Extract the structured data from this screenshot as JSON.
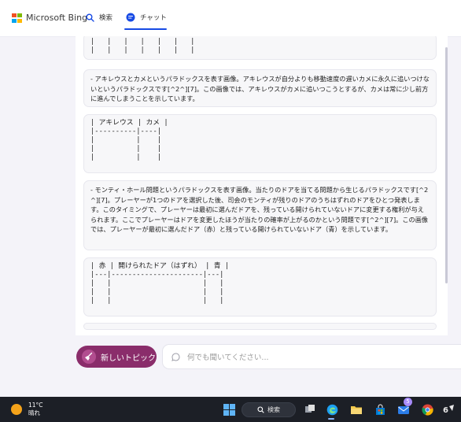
{
  "header": {
    "logo_text": "Microsoft Bing",
    "nav": [
      {
        "label": "検索",
        "icon": "search-icon"
      },
      {
        "label": "チャット",
        "icon": "chat-icon"
      }
    ],
    "active_tab": "チャット"
  },
  "conversation": {
    "table_fragment_top": "|   |   |   |   |   |   |\n|   |   |   |   |   |   |",
    "para1": "- アキレウスとカメというパラドックスを表す画像。アキレウスが自分よりも移動速度の遅いカメに永久に追いつけないというパラドックスです[^2^][7]。この画像では、アキレウスがカメに追いつこうとするが、カメは常に少し前方に進んでしまうことを示しています。",
    "table1": "| アキレウス | カメ |\n|----------|----|\n|          |    |\n|          |    |\n|          |    |",
    "para2": "- モンティ・ホール問題というパラドックスを表す画像。当たりのドアを当てる問題から生じるパラドックスです[^2^][7]。プレーヤーが1つのドアを選択した後、司会のモンティが残りのドアのうちはずれのドアをひとつ発表します。このタイミングで、プレーヤーは最初に選んだドアを、残っている開けられていないドアに変更する権利が与えられます。ここでプレーヤーはドアを変更したほうが当たりの確率が上がるのかという問題です[^2^][7]。この画像では、プレーヤーが最初に選んだドア（赤）と残っている開けられていないドア（青）を示しています。",
    "table2": "| 赤 | 開けられたドア（はずれ） | 青 |\n|---|----------------------|---|\n|   |                      |   |\n|   |                      |   |\n|   |                      |   |"
  },
  "composer": {
    "new_topic_label": "新しいトピック",
    "placeholder": "何でも聞いてください..."
  },
  "taskbar": {
    "temperature": "11°C",
    "condition": "晴れ",
    "search_label": "検索",
    "mail_badge": "5",
    "colors": {
      "bar": "#1c1f26",
      "edge": "#1da1f2",
      "store": "#0078d4",
      "folder": "#f2c94c"
    }
  },
  "colors": {
    "accent": "#174ae4",
    "new_topic": "#8a2d6b"
  }
}
